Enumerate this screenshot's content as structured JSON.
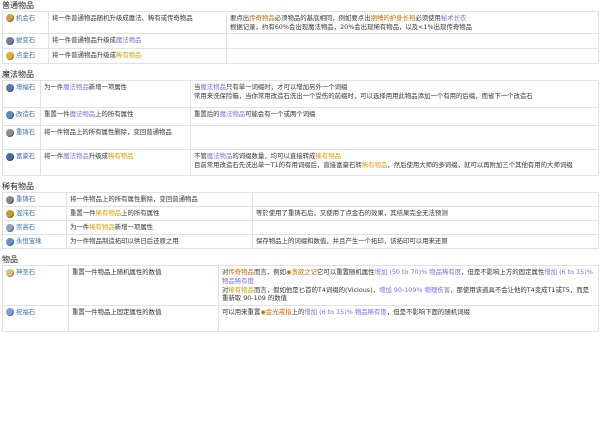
{
  "sections": [
    {
      "title": "普通物品",
      "rows": [
        {
          "name": "机会石",
          "icon": "chance-orb-icon",
          "color": "#c9a24a",
          "effect": [
            {
              "t": "将一件普通物品随机升级成魔法、稀有或传奇物品"
            }
          ],
          "note": [
            {
              "t": "要点出"
            },
            {
              "t": "传奇物品",
              "c": "unique"
            },
            {
              "t": "必须物品的基底相同，例如要点出"
            },
            {
              "t": "捆缚的护身长袍",
              "c": "unique"
            },
            {
              "t": "必须使用"
            },
            {
              "t": "秘术长衣",
              "c": "magic"
            },
            {
              "br": 1
            },
            {
              "t": "根据记录，约有60%会出现魔法物品，20%会出现稀有物品，以及<1%出现传奇物品"
            }
          ]
        },
        {
          "name": "蜕变石",
          "icon": "transmutation-orb-icon",
          "color": "#6f7f9a",
          "effect": [
            {
              "t": "将一件普通物品升级成"
            },
            {
              "t": "魔法物品",
              "c": "magic"
            }
          ],
          "note": []
        },
        {
          "name": "点金石",
          "icon": "alchemy-orb-icon",
          "color": "#e0b030",
          "effect": [
            {
              "t": "将一件普通物品升级成"
            },
            {
              "t": "稀有物品",
              "c": "rare"
            }
          ],
          "note": []
        }
      ]
    },
    {
      "title": "魔法物品",
      "rows": [
        {
          "name": "增幅石",
          "icon": "augmentation-orb-icon",
          "color": "#5b78b5",
          "effect": [
            {
              "t": "为一件"
            },
            {
              "t": "魔法物品",
              "c": "magic"
            },
            {
              "t": "新增一项属性"
            }
          ],
          "note": [
            {
              "t": "当"
            },
            {
              "t": "魔法物品",
              "c": "magic"
            },
            {
              "t": "只有单一词缀时，才可以增加另外一个词缀"
            },
            {
              "br": 1
            },
            {
              "t": "常用来洗保险箱，当你常用改造石洗出一个受伤的前缀时，可以选择用用此物品添加一个有用的后缀，而省下一个改造石"
            }
          ]
        },
        {
          "name": "改造石",
          "icon": "alteration-orb-icon",
          "color": "#5d87c8",
          "effect": [
            {
              "t": "重置一件"
            },
            {
              "t": "魔法物品",
              "c": "magic"
            },
            {
              "t": "上的所有属性"
            }
          ],
          "note": [
            {
              "t": "重置后的"
            },
            {
              "t": "魔法物品",
              "c": "magic"
            },
            {
              "t": "可能会有一个或两个词缀"
            }
          ]
        },
        {
          "name": "重铸石",
          "icon": "scouring-orb-icon",
          "color": "#8a8a8a",
          "effect": [
            {
              "t": "将一件物品上的所有属性删除，变回普通物品"
            }
          ],
          "note": []
        },
        {
          "name": "富豪石",
          "icon": "regal-orb-icon",
          "color": "#4a6aa8",
          "effect": [
            {
              "t": "将一件"
            },
            {
              "t": "魔法物品",
              "c": "magic"
            },
            {
              "t": "升级成"
            },
            {
              "t": "稀有物品",
              "c": "rare"
            }
          ],
          "note": [
            {
              "t": "不管"
            },
            {
              "t": "魔法物品",
              "c": "magic"
            },
            {
              "t": "的词缀数量，均可以直接转成"
            },
            {
              "t": "稀有物品",
              "c": "rare"
            },
            {
              "br": 1
            },
            {
              "t": "目前常用改造石先洗出单一T1的有用词缀后，直接富豪石转"
            },
            {
              "t": "稀有物品",
              "c": "rare"
            },
            {
              "t": "，然后使用大师的多词缀，就可以再附加三个其他有用的大师词缀"
            }
          ]
        }
      ]
    },
    {
      "title": "稀有物品",
      "rows": [
        {
          "name": "重铸石",
          "icon": "scouring-orb-icon",
          "color": "#8a8a8a",
          "effect": [
            {
              "t": "将一件物品上的所有属性删除，变回普通物品"
            }
          ],
          "note": []
        },
        {
          "name": "混沌石",
          "icon": "chaos-orb-icon",
          "color": "#c99a2e",
          "effect": [
            {
              "t": "重置一件"
            },
            {
              "t": "稀有物品",
              "c": "rare"
            },
            {
              "t": "上的所有属性"
            }
          ],
          "note": [
            {
              "t": "等於使用了重铸石后，又使用了点金石的效果，其结果完全无法预测"
            }
          ]
        },
        {
          "name": "崇高石",
          "icon": "exalted-orb-icon",
          "color": "#8f9fc0",
          "effect": [
            {
              "t": "为一件"
            },
            {
              "t": "稀有物品",
              "c": "rare"
            },
            {
              "t": "新增一项属性"
            }
          ],
          "note": []
        },
        {
          "name": "永恒宝珠",
          "icon": "eternal-orb-icon",
          "color": "#6a8fd0",
          "effect": [
            {
              "t": "为一件物品制造拓印以供日后还原之用"
            }
          ],
          "note": [
            {
              "t": "保存物品上的词缀和数值，并且产生一个拓印，该拓印可以用来还原"
            }
          ]
        }
      ]
    },
    {
      "title": "物品",
      "rows": [
        {
          "name": "神圣石",
          "icon": "divine-orb-icon",
          "color": "#d8c070",
          "effect": [
            {
              "t": "重置一件物品上随机属性的数值"
            }
          ],
          "note": [
            {
              "t": "对"
            },
            {
              "t": "传奇物品",
              "c": "unique"
            },
            {
              "t": "而言，例如"
            },
            {
              "t": "◉贪欲之记",
              "c": "unique"
            },
            {
              "t": "它可以重置随机属性"
            },
            {
              "t": "增加 (50 to 70)% 物品稀有度",
              "c": "mod"
            },
            {
              "t": "，但是不影响上方的固定属性"
            },
            {
              "t": "增加 (6 to 15)% 物品稀有度",
              "c": "mod"
            },
            {
              "br": 1
            },
            {
              "t": "对"
            },
            {
              "t": "稀有物品",
              "c": "rare"
            },
            {
              "t": "而言，假如他是匕首的T4词缀的(Vicious)，"
            },
            {
              "t": "增加 90-109% 物理伤害",
              "c": "mod"
            },
            {
              "t": "，那使用该道具不会让他的T4变成T1或T5，而是重新取 90-109 的数值"
            }
          ]
        },
        {
          "name": "祝福石",
          "icon": "blessed-orb-icon",
          "color": "#7aa2d8",
          "effect": [
            {
              "t": "重置一件物品上固定属性的数值"
            }
          ],
          "note": [
            {
              "t": "可以用来重置"
            },
            {
              "t": "◉金光戒指",
              "c": "unique"
            },
            {
              "t": "上的"
            },
            {
              "t": "增加 (6 to 15)% 物品稀有度",
              "c": "mod"
            },
            {
              "t": "，但是不影响下面的随机词缀"
            }
          ]
        }
      ]
    }
  ]
}
